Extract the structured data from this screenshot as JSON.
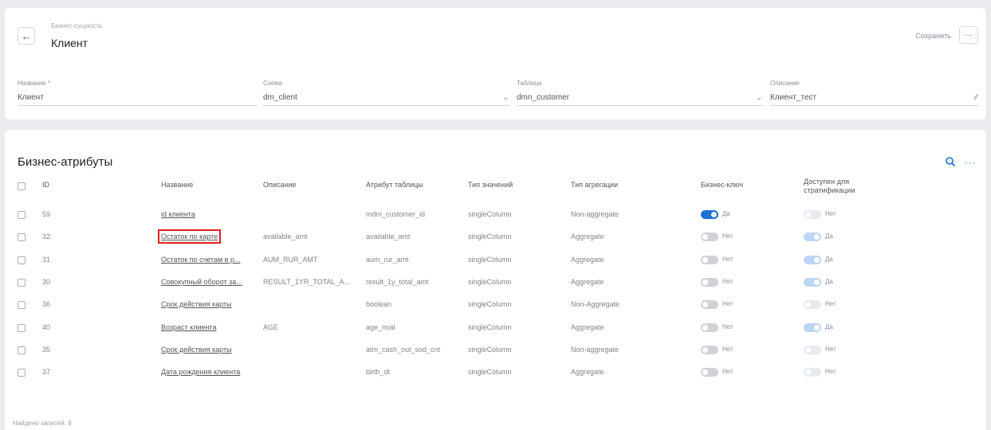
{
  "header": {
    "breadcrumb": "Бизнес-сущность",
    "title": "Клиент",
    "save_label": "Сохранить",
    "more_label": "···"
  },
  "fields": {
    "name": {
      "label": "Название *",
      "value": "Клиент"
    },
    "schema": {
      "label": "Схема",
      "value": "dm_client"
    },
    "table": {
      "label": "Таблица",
      "value": "dmn_customer"
    },
    "description": {
      "label": "Описание",
      "value": "Клиент_тест"
    }
  },
  "attributes": {
    "title": "Бизнес-атрибуты",
    "more_label": "···",
    "columns": {
      "id": "ID",
      "name": "Название",
      "desc": "Описание",
      "table_attr": "Атрибут таблицы",
      "value_type": "Тип значений",
      "agg_type": "Тип агрегации",
      "business_key": "Бизнес-ключ",
      "strat_1": "Доступен для",
      "strat_2": "стратификации"
    },
    "rows": [
      {
        "id": "59",
        "name": "id клиента",
        "desc": "",
        "table_attr": "mdm_customer_id",
        "value_type": "singleColumn",
        "agg_type": "Non-aggregate",
        "key": "Да",
        "key_on": true,
        "strat": "Нет",
        "strat_on": false
      },
      {
        "id": "32",
        "name": "Остаток по карте",
        "desc": "available_amt",
        "table_attr": "available_amt",
        "value_type": "singleColumn",
        "agg_type": "Aggregate",
        "key": "Нет",
        "key_on": false,
        "strat": "Да",
        "strat_on": true
      },
      {
        "id": "31",
        "name": "Остаток по счетам в р...",
        "desc": "AUM_RUR_AMT",
        "table_attr": "aum_rur_amt",
        "value_type": "singleColumn",
        "agg_type": "Aggregate",
        "key": "Нет",
        "key_on": false,
        "strat": "Да",
        "strat_on": true
      },
      {
        "id": "30",
        "name": "Совокупный оборот за...",
        "desc": "RESULT_1YR_TOTAL_A...",
        "table_attr": "result_1y_total_amt",
        "value_type": "singleColumn",
        "agg_type": "Aggregate",
        "key": "Нет",
        "key_on": false,
        "strat": "Да",
        "strat_on": true
      },
      {
        "id": "36",
        "name": "Срок действия карты",
        "desc": "",
        "table_attr": "boolean",
        "value_type": "singleColumn",
        "agg_type": "Non-Aggregate",
        "key": "Нет",
        "key_on": false,
        "strat": "Нет",
        "strat_on": false
      },
      {
        "id": "40",
        "name": "Возраст клиента",
        "desc": "AGE",
        "table_attr": "age_nval",
        "value_type": "singleColumn",
        "agg_type": "Aggregate",
        "key": "Нет",
        "key_on": false,
        "strat": "Да",
        "strat_on": true
      },
      {
        "id": "35",
        "name": "Срок действия карты",
        "desc": "",
        "table_attr": "atm_cash_out_sod_cnt",
        "value_type": "singleColumn",
        "agg_type": "Non-aggregate",
        "key": "Нет",
        "key_on": false,
        "strat": "Нет",
        "strat_on": false
      },
      {
        "id": "37",
        "name": "Дата рождения клиента",
        "desc": "",
        "table_attr": "birth_dt",
        "value_type": "singleColumn",
        "agg_type": "Aggregate",
        "key": "Нет",
        "key_on": false,
        "strat": "Нет",
        "strat_on": false
      }
    ]
  },
  "footer": {
    "found_label": "Найдено записей:",
    "count": "8"
  },
  "colors": {
    "accent": "#1f6fd0",
    "highlight": "#e02020"
  }
}
